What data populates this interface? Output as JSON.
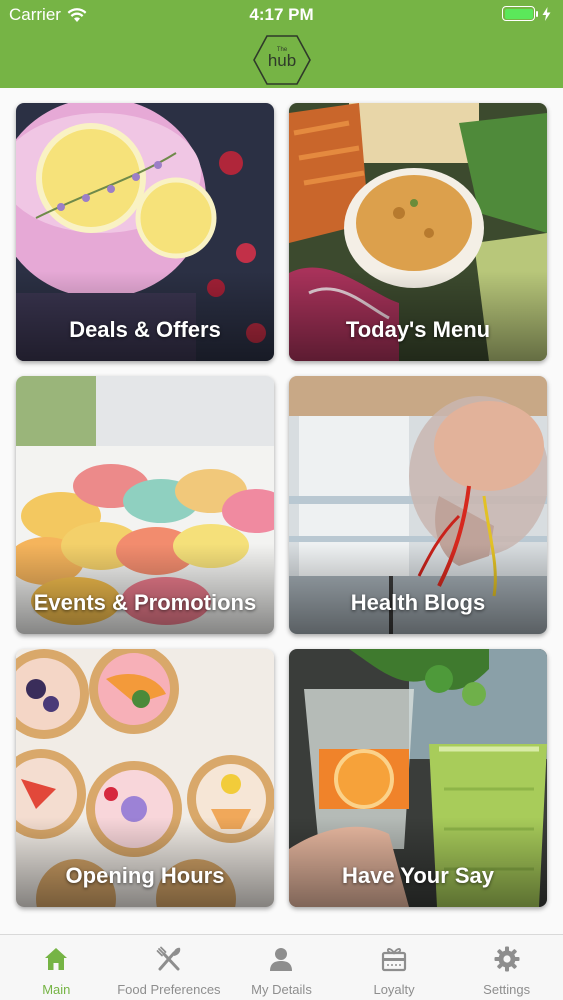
{
  "status_bar": {
    "carrier": "Carrier",
    "time": "4:17 PM",
    "battery_color": "#5be85a"
  },
  "header": {
    "logo_text": "hub",
    "logo_small_text": "The",
    "bg_color": "#76b445"
  },
  "tiles": [
    {
      "label": "Deals & Offers",
      "image": "gin-lemon-drink"
    },
    {
      "label": "Today's Menu",
      "image": "platter-dip-chips"
    },
    {
      "label": "Events & Promotions",
      "image": "macarons-box"
    },
    {
      "label": "Health Blogs",
      "image": "anatomical-head-model"
    },
    {
      "label": "Opening Hours",
      "image": "fruit-tarts"
    },
    {
      "label": "Have Your Say",
      "image": "juice-glasses"
    }
  ],
  "tab_bar": {
    "active_color": "#76b445",
    "inactive_color": "#8e8e8e",
    "tabs": [
      {
        "label": "Main",
        "icon": "home-icon",
        "active": true
      },
      {
        "label": "Food Preferences",
        "icon": "fork-knife-icon",
        "active": false
      },
      {
        "label": "My Details",
        "icon": "person-icon",
        "active": false
      },
      {
        "label": "Loyalty",
        "icon": "gift-card-icon",
        "active": false
      },
      {
        "label": "Settings",
        "icon": "gear-icon",
        "active": false
      }
    ]
  }
}
